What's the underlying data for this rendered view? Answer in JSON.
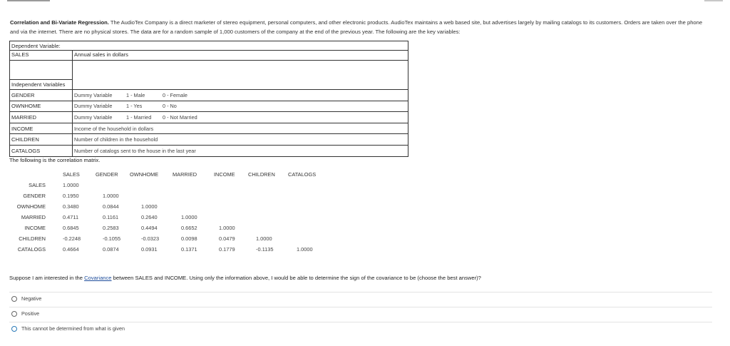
{
  "intro": {
    "lead": "Correlation and Bi-Variate Regression.",
    "body": "The AudioTex Company is a direct marketer of stereo equipment, personal computers, and other electronic products. AudioTex maintains a web based site, but advertises largely by mailing catalogs to its customers. Orders are taken over the phone and via the internet. There are no physical stores. The data are for a random sample of 1,000 customers of the company at the end of the previous year. The following are the key variables:"
  },
  "variables": {
    "dependent_heading": "Dependent Variable:",
    "dependent": {
      "name": "SALES",
      "description": "Annual sales in dollars"
    },
    "independent_heading": "Independent Variables",
    "independent": [
      {
        "name": "GENDER",
        "parts": [
          "Dummy Variable",
          "1 - Male",
          "0 - Female"
        ]
      },
      {
        "name": "OWNHOME",
        "parts": [
          "Dummy Variable",
          "1 - Yes",
          "0 - No"
        ]
      },
      {
        "name": "MARRIED",
        "parts": [
          "Dummy Variable",
          "1 - Married",
          "0 - Not Married"
        ]
      },
      {
        "name": "INCOME",
        "parts": [
          "Income of the household in dollars",
          "",
          ""
        ]
      },
      {
        "name": "CHILDREN",
        "parts": [
          "Number of children in the household",
          "",
          ""
        ]
      },
      {
        "name": "CATALOGS",
        "parts": [
          "Number of catalogs sent to the house in the last year",
          "",
          ""
        ]
      }
    ]
  },
  "correlation": {
    "title": "The following is the correlation matrix.",
    "headers": [
      "SALES",
      "GENDER",
      "OWNHOME",
      "MARRIED",
      "INCOME",
      "CHILDREN",
      "CATALOGS"
    ],
    "rows": [
      {
        "label": "SALES",
        "values": [
          "1.0000"
        ]
      },
      {
        "label": "GENDER",
        "values": [
          "0.1950",
          "1.0000"
        ]
      },
      {
        "label": "OWNHOME",
        "values": [
          "0.3480",
          "0.0844",
          "1.0000"
        ]
      },
      {
        "label": "MARRIED",
        "values": [
          "0.4711",
          "0.1161",
          "0.2640",
          "1.0000"
        ]
      },
      {
        "label": "INCOME",
        "values": [
          "0.6845",
          "0.2583",
          "0.4494",
          "0.6652",
          "1.0000"
        ]
      },
      {
        "label": "CHILDREN",
        "values": [
          "-0.2248",
          "-0.1055",
          "-0.0323",
          "0.0098",
          "0.0479",
          "1.0000"
        ]
      },
      {
        "label": "CATALOGS",
        "values": [
          "0.4664",
          "0.0874",
          "0.0931",
          "0.1371",
          "0.1779",
          "-0.1135",
          "1.0000"
        ]
      }
    ]
  },
  "question": {
    "before": "Suppose I am interested in the ",
    "link": "Covariance",
    "after": " between SALES and INCOME. Using only the information above, I would be able to determine the sign of the covariance to be (choose the best answer)?"
  },
  "options": [
    "Negative",
    "Positive",
    "This cannot be determined from what is given"
  ]
}
